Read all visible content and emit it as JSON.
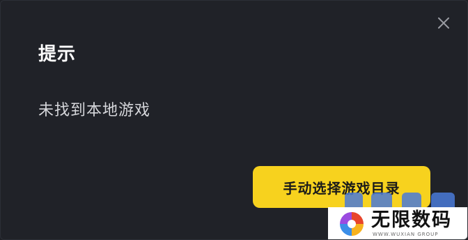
{
  "dialog": {
    "title": "提示",
    "message": "未找到本地游戏",
    "primary_button": "手动选择游戏目录",
    "close_icon": "close-icon"
  },
  "watermark": {
    "brand": "无限数码",
    "url": "WWW.WUXIAN GROUP"
  },
  "colors": {
    "background": "#202228",
    "title": "#ffffff",
    "message": "#d6d7db",
    "accent": "#f7d21e",
    "button_text": "#1a1a1a"
  }
}
